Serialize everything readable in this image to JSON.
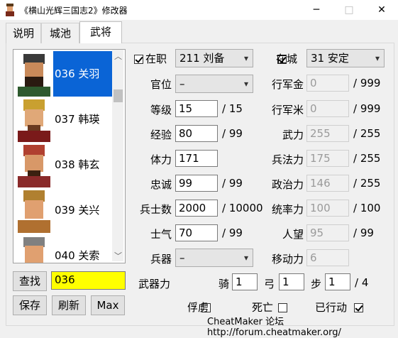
{
  "window": {
    "title": "《横山光辉三国志2》修改器",
    "minimize": "─",
    "maximize": "□",
    "close": "✕"
  },
  "tabs": [
    {
      "label": "说明"
    },
    {
      "label": "城池"
    },
    {
      "label": "武将"
    }
  ],
  "list": {
    "items": [
      {
        "label": "036 关羽",
        "selected": true
      },
      {
        "label": "037 韩瑛"
      },
      {
        "label": "038 韩玄"
      },
      {
        "label": "039 关兴"
      },
      {
        "label": "040 关索"
      }
    ],
    "scroll_up": "︿",
    "scroll_down": "﹀"
  },
  "search": {
    "button": "查找",
    "value": "036"
  },
  "actions": {
    "save": "保存",
    "refresh": "刷新",
    "max": "Max"
  },
  "form": {
    "in_office": {
      "label": "在职",
      "checked": true,
      "value": "211 刘备"
    },
    "in_city": {
      "label": "在城",
      "checked": true,
      "value": "31 安定"
    },
    "post": {
      "label": "官位",
      "value": "–"
    },
    "march_gold": {
      "label": "行军金",
      "value": "0",
      "max": "/ 999"
    },
    "level": {
      "label": "等级",
      "value": "15",
      "max": "/ 15"
    },
    "march_rice": {
      "label": "行军米",
      "value": "0",
      "max": "/ 999"
    },
    "exp": {
      "label": "经验",
      "value": "80",
      "max": "/ 99"
    },
    "force": {
      "label": "武力",
      "value": "255",
      "max": "/ 255"
    },
    "hp": {
      "label": "体力",
      "value": "171"
    },
    "tactics": {
      "label": "兵法力",
      "value": "175",
      "max": "/ 255"
    },
    "loyalty": {
      "label": "忠诚",
      "value": "99",
      "max": "/ 99"
    },
    "politics": {
      "label": "政治力",
      "value": "146",
      "max": "/ 255"
    },
    "soldiers": {
      "label": "兵士数",
      "value": "2000",
      "max": "/ 10000"
    },
    "command": {
      "label": "统率力",
      "value": "100",
      "max": "/ 100"
    },
    "morale": {
      "label": "士气",
      "value": "70",
      "max": "/ 99"
    },
    "reputation": {
      "label": "人望",
      "value": "95",
      "max": "/ 99"
    },
    "weapon": {
      "label": "兵器",
      "value": "–"
    },
    "movement": {
      "label": "移动力",
      "value": "6"
    },
    "weapon_power": {
      "label": "武器力",
      "cavalry_label": "骑",
      "cavalry": "1",
      "bow_label": "弓",
      "bow": "1",
      "foot_label": "步",
      "foot": "1",
      "max": "/ 4"
    },
    "captive": {
      "label": "俘虏",
      "checked": false
    },
    "dead": {
      "label": "死亡",
      "checked": false
    },
    "acted": {
      "label": "已行动",
      "checked": true
    }
  },
  "footer": {
    "text": "CheatMaker 论坛 http://forum.cheatmaker.org/"
  },
  "colors": {
    "selection": "#0a64d6",
    "search_field": "#ffff00"
  }
}
